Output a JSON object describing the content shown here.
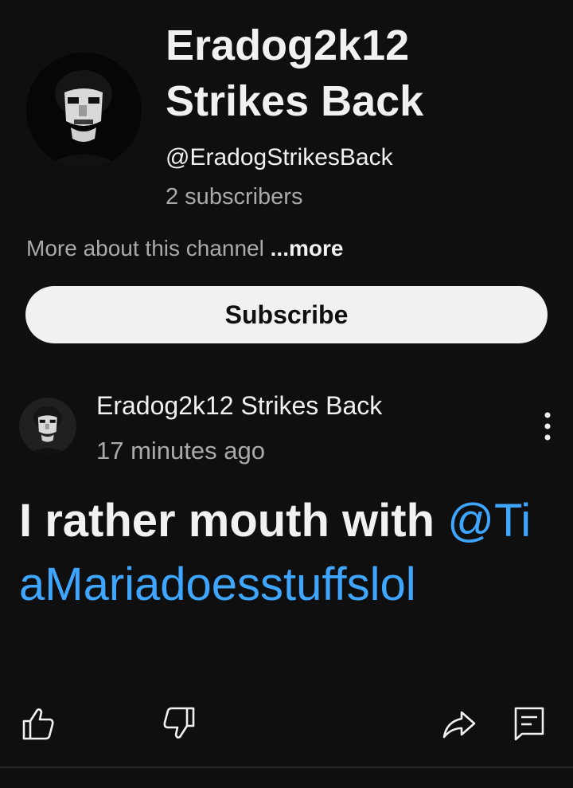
{
  "channel": {
    "name_line1": "Eradog2k12",
    "name_line2": "Strikes Back",
    "handle": "@EradogStrikesBack",
    "subscribers": "2 subscribers",
    "about_text": "More about this channel ",
    "about_more": "...more",
    "subscribe_label": "Subscribe",
    "avatar_icon": "dark-face-avatar-icon"
  },
  "post": {
    "author": "Eradog2k12 Strikes Back",
    "time": "17 minutes ago",
    "text": "I rather mouth with ",
    "mention": "@TiaMariadoesstuffslol",
    "menu_icon": "more-vert-icon"
  },
  "actions": [
    {
      "name": "like",
      "icon": "thumbs-up-icon"
    },
    {
      "name": "dislike",
      "icon": "thumbs-down-icon"
    },
    {
      "name": "share",
      "icon": "share-icon"
    },
    {
      "name": "comments",
      "icon": "comment-icon"
    }
  ],
  "colors": {
    "background": "#0f0f0f",
    "text_primary": "#f1f1f1",
    "text_secondary": "#aaaaaa",
    "link": "#3ea6ff",
    "button_bg": "#f1f1f1"
  }
}
